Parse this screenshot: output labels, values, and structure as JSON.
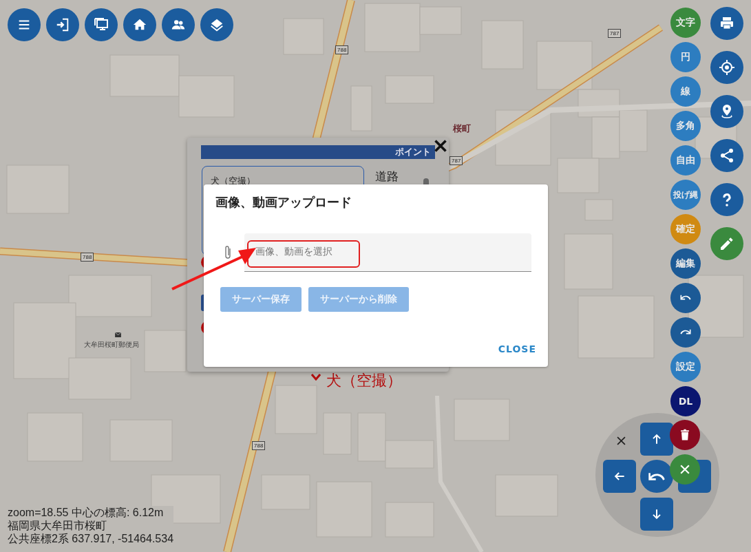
{
  "map": {
    "route_shields": [
      "788",
      "787",
      "788",
      "787",
      "788"
    ],
    "place_label": "桜町",
    "post_office": "大牟田桜町郵便局",
    "marker_label": "犬（空撮）"
  },
  "popup": {
    "header": "ポイント",
    "name_value": "犬（空撮）",
    "field_label": "道路"
  },
  "dialog": {
    "title": "画像、動画アップロード",
    "file_placeholder": "画像、動画を選択",
    "buttons": [
      {
        "label": "サーバー保存",
        "disabled": true
      },
      {
        "label": "サーバーから削除",
        "disabled": true
      }
    ],
    "close": "CLOSE"
  },
  "draw_tools": [
    {
      "kind": "text",
      "label": "文字",
      "color": "#3a8a3e"
    },
    {
      "kind": "text",
      "label": "円",
      "color": "#2d7dc0"
    },
    {
      "kind": "text",
      "label": "線",
      "color": "#2d7dc0"
    },
    {
      "kind": "text",
      "label": "多角",
      "color": "#2d7dc0"
    },
    {
      "kind": "text",
      "label": "自由",
      "color": "#2d7dc0"
    },
    {
      "kind": "text",
      "label": "投げ縄",
      "color": "#2d7dc0"
    },
    {
      "kind": "text",
      "label": "確定",
      "color": "#d08a12"
    },
    {
      "kind": "text",
      "label": "編集",
      "color": "#1c5a96"
    },
    {
      "kind": "undo",
      "color": "#1c5a96"
    },
    {
      "kind": "redo",
      "color": "#1c5a96"
    },
    {
      "kind": "text",
      "label": "設定",
      "color": "#2d7dc0"
    },
    {
      "kind": "text",
      "label": "DL",
      "color": "#0b1670"
    }
  ],
  "status": {
    "lines": [
      "zoom=18.55 中心の標高: 6.12m",
      "福岡県大牟田市桜町",
      "公共座標2系 637.917, -51464.534"
    ]
  }
}
